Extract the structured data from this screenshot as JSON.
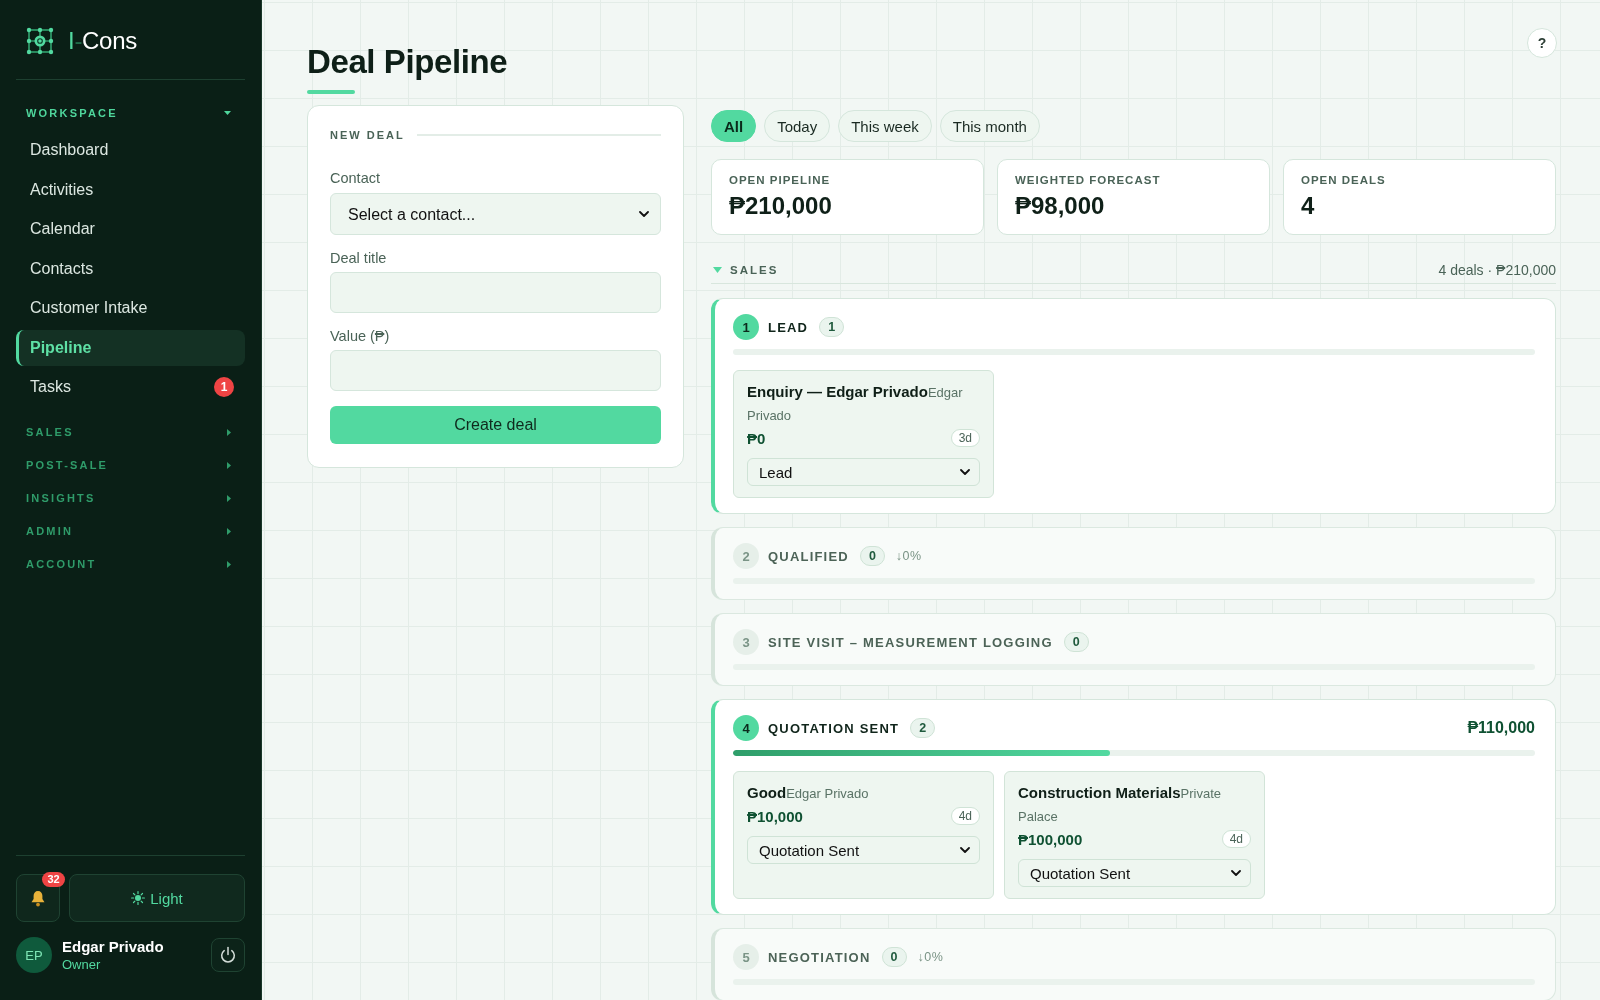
{
  "sidebar": {
    "logo": {
      "mark": "I",
      "dash": "-",
      "name": "Cons"
    },
    "sections": [
      {
        "title": "WORKSPACE",
        "expanded": true,
        "items": [
          {
            "label": "Dashboard",
            "selected": false
          },
          {
            "label": "Activities",
            "selected": false
          },
          {
            "label": "Calendar",
            "selected": false
          },
          {
            "label": "Contacts",
            "selected": false
          },
          {
            "label": "Customer Intake",
            "selected": false
          },
          {
            "label": "Pipeline",
            "selected": true
          },
          {
            "label": "Tasks",
            "selected": false,
            "badge": "1"
          }
        ]
      },
      {
        "title": "SALES",
        "expanded": false
      },
      {
        "title": "POST-SALE",
        "expanded": false
      },
      {
        "title": "INSIGHTS",
        "expanded": false
      },
      {
        "title": "ADMIN",
        "expanded": false
      },
      {
        "title": "ACCOUNT",
        "expanded": false
      }
    ],
    "notifications": {
      "badge": "32"
    },
    "theme_button": {
      "label": "Light"
    },
    "user": {
      "initials": "EP",
      "name": "Edgar Privado",
      "role": "Owner"
    }
  },
  "page": {
    "title": "Deal Pipeline",
    "help": "?"
  },
  "new_deal": {
    "title": "NEW DEAL",
    "fields": [
      {
        "kind": "select",
        "label": "Contact",
        "placeholder": "Select a contact..."
      },
      {
        "kind": "text",
        "label": "Deal title"
      },
      {
        "kind": "text",
        "label": "Value (₱)"
      }
    ],
    "submit": "Create deal"
  },
  "filters": [
    {
      "label": "All",
      "selected": true
    },
    {
      "label": "Today",
      "selected": false
    },
    {
      "label": "This week",
      "selected": false
    },
    {
      "label": "This month",
      "selected": false
    }
  ],
  "stats": [
    {
      "label": "OPEN PIPELINE",
      "value": "₱210,000"
    },
    {
      "label": "WEIGHTED FORECAST",
      "value": "₱98,000"
    },
    {
      "label": "OPEN DEALS",
      "value": "4"
    }
  ],
  "pipeline": {
    "group": {
      "title": "SALES",
      "expanded": true,
      "summary": "4 deals · ₱210,000"
    },
    "stages": [
      {
        "number": "1",
        "name": "LEAD",
        "count": "1",
        "active": true,
        "level": 0,
        "deals": [
          {
            "title": "Enquiry — Edgar Privado",
            "contact": "Edgar Privado",
            "value": "₱0",
            "age": "3d",
            "stage": "Lead"
          }
        ]
      },
      {
        "number": "2",
        "name": "QUALIFIED",
        "count": "0",
        "conversion": "↓0%",
        "active": false,
        "level": 0
      },
      {
        "number": "3",
        "name": "SITE VISIT – MEASUREMENT LOGGING",
        "count": "0",
        "active": false,
        "level": 0
      },
      {
        "number": "4",
        "name": "QUOTATION SENT",
        "count": "2",
        "amount": "₱110,000",
        "active": true,
        "level": 0.47,
        "deals": [
          {
            "title": "Good",
            "contact": "Edgar Privado",
            "value": "₱10,000",
            "age": "4d",
            "stage": "Quotation Sent"
          },
          {
            "title": "Construction Materials",
            "contact": "Private Palace",
            "value": "₱100,000",
            "age": "4d",
            "stage": "Quotation Sent"
          }
        ]
      },
      {
        "number": "5",
        "name": "NEGOTIATION",
        "count": "0",
        "conversion": "↓0%",
        "active": false,
        "level": 0
      }
    ]
  }
}
